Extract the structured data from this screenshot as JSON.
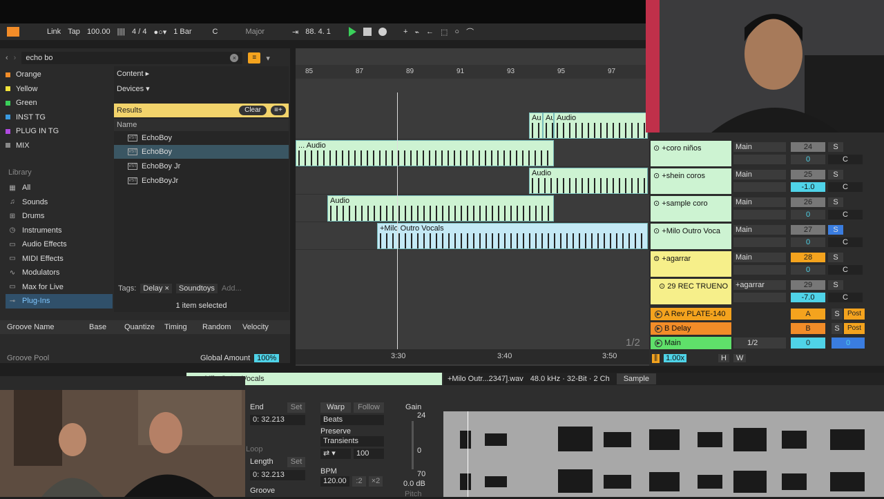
{
  "transport": {
    "link": "Link",
    "tap": "Tap",
    "tempo": "100.00",
    "signature": "4 / 4",
    "quantize": "1 Bar",
    "key": "C",
    "scale": "Major",
    "position": "88.  4.  1"
  },
  "browser": {
    "search": "echo bo",
    "collections": [
      {
        "label": "Orange",
        "color": "#f28c28"
      },
      {
        "label": "Yellow",
        "color": "#f2e33a"
      },
      {
        "label": "Green",
        "color": "#3ad05a"
      },
      {
        "label": "INST TG",
        "color": "#3a9ae0"
      },
      {
        "label": "PLUG IN TG",
        "color": "#b04ae0"
      },
      {
        "label": "MIX",
        "color": "#888888"
      }
    ],
    "library_title": "Library",
    "library": [
      {
        "label": "All",
        "icon": "grid-icon"
      },
      {
        "label": "Sounds",
        "icon": "note-icon"
      },
      {
        "label": "Drums",
        "icon": "drums-icon"
      },
      {
        "label": "Instruments",
        "icon": "instrument-icon"
      },
      {
        "label": "Audio Effects",
        "icon": "audio-effects-icon"
      },
      {
        "label": "MIDI Effects",
        "icon": "midi-effects-icon"
      },
      {
        "label": "Modulators",
        "icon": "modulators-icon"
      },
      {
        "label": "Max for Live",
        "icon": "max-icon"
      },
      {
        "label": "Plug-Ins",
        "icon": "plugin-icon",
        "selected": true
      }
    ],
    "content": "Content ▸",
    "devices": "Devices ▾",
    "results": "Results",
    "clear": "Clear",
    "name_header": "Name",
    "items": [
      "EchoBoy",
      "EchoBoy",
      "EchoBoy Jr",
      "EchoBoyJr"
    ],
    "tags_label": "Tags:",
    "tag1": "Delay ×",
    "tag2": "Soundtoys",
    "tag_add": "Add...",
    "selection": "1 item selected"
  },
  "groove": {
    "headers": [
      "Groove Name",
      "Base",
      "Quantize",
      "Timing",
      "Random",
      "Velocity"
    ],
    "pool": "Groove Pool",
    "global_amount_label": "Global Amount",
    "global_amount": "100%"
  },
  "arrangement": {
    "bars": [
      "85",
      "87",
      "89",
      "91",
      "93",
      "95",
      "97"
    ],
    "times": [
      "3:30",
      "3:40",
      "3:50"
    ],
    "page": "1/2",
    "clips": {
      "c1": "Au",
      "c2": "Au",
      "c3": "Audio",
      "c4": "... Audio",
      "c5": "Audio",
      "c6": "Audio",
      "c7": "+Milo Outro Vocals"
    }
  },
  "tracks": [
    {
      "name": "+coro niños",
      "output": "Main",
      "num": "24",
      "vol": "0",
      "pan": "C"
    },
    {
      "name": "+shein coros",
      "output": "Main",
      "num": "25",
      "vol": "-1.0",
      "pan": "C"
    },
    {
      "name": "+sample coro",
      "output": "Main",
      "num": "26",
      "vol": "0",
      "pan": "C"
    },
    {
      "name": "+Milo Outro Voca",
      "output": "Main",
      "num": "27",
      "vol": "0",
      "pan": "C"
    },
    {
      "name": "+agarrar",
      "output": "Main",
      "num": "28",
      "vol": "0",
      "pan": "C"
    },
    {
      "name": "29 REC TRUENO",
      "output": "+agarrar",
      "num": "29",
      "vol": "-7.0",
      "pan": "C"
    }
  ],
  "returns": [
    {
      "name": "A Rev PLATE-140",
      "letter": "A",
      "post": "Post",
      "s": "S"
    },
    {
      "name": "B Delay",
      "letter": "B",
      "post": "Post",
      "s": "S"
    }
  ],
  "main": {
    "name": "Main",
    "ratio": "1/2",
    "vol": "0",
    "pan": "0"
  },
  "mixer_footer": {
    "zoom": "1.00x",
    "h": "H",
    "w": "W"
  },
  "detail": {
    "clip_title": "+Milo Outro Vocals",
    "end_label": "End",
    "end_set": "Set",
    "end_value": "0:  32.213",
    "loop_label": "Loop",
    "length_label": "Length",
    "length_set": "Set",
    "length_value": "0:  32.213",
    "groove_label": "Groove",
    "warp": "Warp",
    "follow": "Follow",
    "warp_mode": "Beats",
    "preserve_label": "Preserve",
    "preserve": "Transients",
    "amount": "100",
    "bpm_label": "BPM",
    "bpm": "120.00",
    "half": ":2",
    "double": "×2",
    "gain_label": "Gain",
    "gain_top": "24",
    "gain_zero": "0",
    "gain_bottom": "70",
    "gain_value": "0.0 dB",
    "pitch_label": "Pitch",
    "file": "+Milo Outr...2347].wav",
    "format": "48.0 kHz · 32-Bit · 2 Ch",
    "sample_tab": "Sample"
  }
}
